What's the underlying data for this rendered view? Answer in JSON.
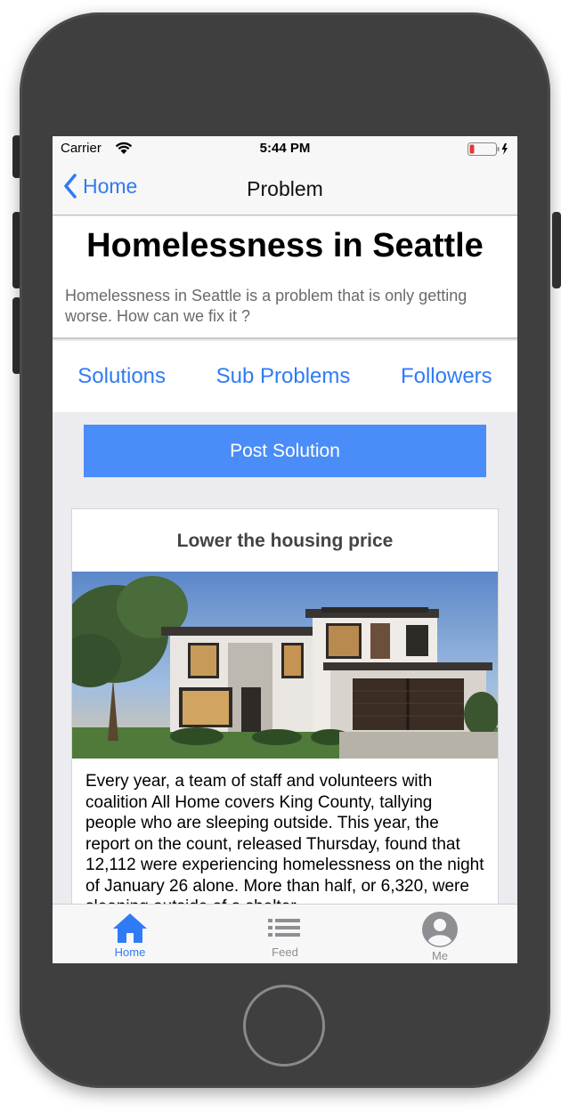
{
  "status": {
    "carrier": "Carrier",
    "time": "5:44 PM"
  },
  "nav": {
    "back_label": "Home",
    "title": "Problem"
  },
  "problem": {
    "title": "Homelessness in Seattle",
    "description": "Homelessness in Seattle is a problem that is only getting worse. How can we fix it ?"
  },
  "tabs": [
    {
      "label": "Solutions"
    },
    {
      "label": "Sub Problems"
    },
    {
      "label": "Followers"
    }
  ],
  "post_button": "Post Solution",
  "solution": {
    "title": "Lower the housing price",
    "text": "Every year, a team of staff and volunteers with coalition All Home covers King County, tallying people who are sleeping outside. This year, the report on the count, released Thursday, found that 12,112 were experiencing homelessness on the night of January 26 alone. More than half, or 6,320, were sleeping outside of a shelter."
  },
  "bottom_tabs": [
    {
      "label": "Home",
      "icon": "home-icon",
      "active": true
    },
    {
      "label": "Feed",
      "icon": "list-icon",
      "active": false
    },
    {
      "label": "Me",
      "icon": "user-icon",
      "active": false
    }
  ],
  "colors": {
    "accent": "#2f7bf5",
    "button": "#4a8df8",
    "battery_low": "#e03b3b"
  }
}
